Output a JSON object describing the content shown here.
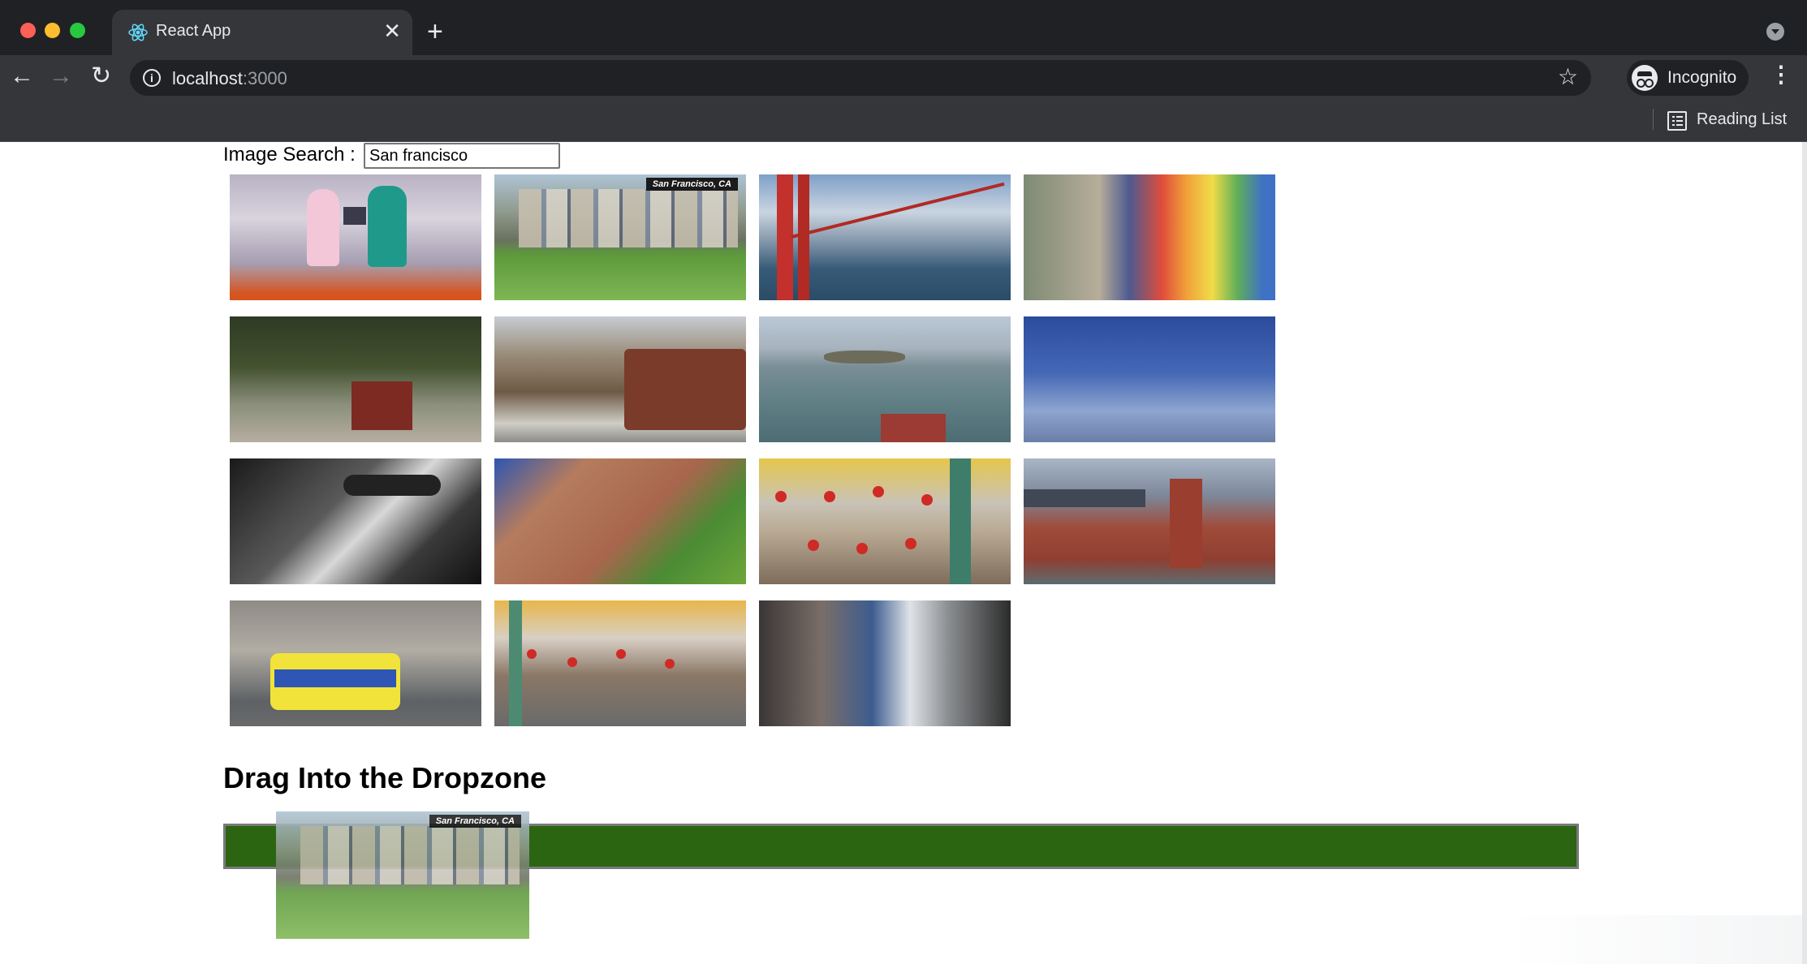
{
  "browser": {
    "tab_title": "React App",
    "tab_close": "✕",
    "new_tab": "+",
    "url_host": "localhost",
    "url_port": ":3000",
    "profile_label": "Incognito",
    "bookmarks": {
      "reading_list": "Reading List"
    }
  },
  "page": {
    "search": {
      "label": "Image Search :",
      "value": "San francisco"
    },
    "images": [
      {
        "alt": "spin class bikes",
        "icon": "image-icon"
      },
      {
        "alt": "painted ladies",
        "overlay": "San Francisco, CA"
      },
      {
        "alt": "golden gate bridge"
      },
      {
        "alt": "rainbow mural"
      },
      {
        "alt": "cable car trees"
      },
      {
        "alt": "cable car street"
      },
      {
        "alt": "alcatraz bay"
      },
      {
        "alt": "bay blue sky"
      },
      {
        "alt": "man in hat black and white"
      },
      {
        "alt": "palace of fine arts"
      },
      {
        "alt": "chinatown lanterns"
      },
      {
        "alt": "ferry building bay bridge"
      },
      {
        "alt": "yellow streetcar"
      },
      {
        "alt": "chinatown flags"
      },
      {
        "alt": "downtown skyscrapers"
      }
    ],
    "dropzone_title": "Drag Into the Dropzone",
    "drag_ghost_overlay": "San Francisco, CA",
    "colors": {
      "dropzone": "#2b6511",
      "chrome": "#35363a",
      "tab_strip": "#202124"
    }
  }
}
